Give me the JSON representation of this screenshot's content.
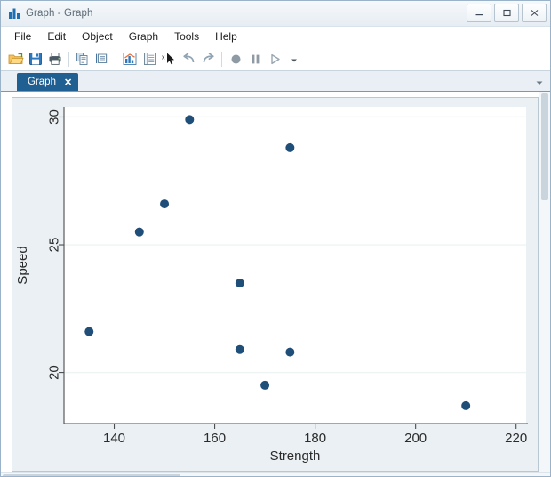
{
  "window": {
    "title": "Graph - Graph",
    "app_icon": "bar-chart-icon",
    "controls": {
      "minimize": "–",
      "maximize": "□",
      "close": "✕"
    }
  },
  "menu": {
    "items": [
      {
        "label": "File"
      },
      {
        "label": "Edit"
      },
      {
        "label": "Object"
      },
      {
        "label": "Graph"
      },
      {
        "label": "Tools"
      },
      {
        "label": "Help"
      }
    ]
  },
  "toolbar": {
    "buttons": [
      {
        "name": "open-folder-icon",
        "tooltip": "Open"
      },
      {
        "name": "save-icon",
        "tooltip": "Save"
      },
      {
        "name": "print-icon",
        "tooltip": "Print"
      },
      {
        "name": "copy-icon",
        "tooltip": "Copy"
      },
      {
        "name": "paste-object-icon",
        "tooltip": "Paste"
      },
      {
        "name": "new-graph-icon",
        "tooltip": "New Graph"
      },
      {
        "name": "grid-editor-icon",
        "tooltip": "Grid Editor"
      },
      {
        "name": "pointer-select-icon",
        "tooltip": "Select"
      },
      {
        "name": "undo-icon",
        "tooltip": "Undo"
      },
      {
        "name": "redo-icon",
        "tooltip": "Redo"
      },
      {
        "name": "record-icon",
        "tooltip": "Record"
      },
      {
        "name": "pause-icon",
        "tooltip": "Pause"
      },
      {
        "name": "play-icon",
        "tooltip": "Play"
      },
      {
        "name": "chevron-down-icon",
        "tooltip": "More"
      }
    ]
  },
  "tabs": {
    "items": [
      {
        "label": "Graph",
        "close": "✕",
        "active": true
      }
    ],
    "dropdown_icon": "chevron-down-icon"
  },
  "chart_data": {
    "type": "scatter",
    "title": "",
    "xlabel": "Strength",
    "ylabel": "Speed",
    "xlim": [
      130,
      222
    ],
    "ylim": [
      18.0,
      30.4
    ],
    "xticks": [
      140,
      160,
      180,
      200,
      220
    ],
    "yticks": [
      20,
      25,
      30
    ],
    "grid": "horizontal",
    "marker_color": "#1f4e79",
    "marker_size": 5,
    "plot_bg": "#ffffff",
    "figure_bg": "#eaf0f3",
    "points": [
      {
        "x": 135.0,
        "y": 21.6
      },
      {
        "x": 145.0,
        "y": 25.5
      },
      {
        "x": 150.0,
        "y": 26.6
      },
      {
        "x": 155.0,
        "y": 29.9
      },
      {
        "x": 165.0,
        "y": 23.5
      },
      {
        "x": 165.0,
        "y": 20.9
      },
      {
        "x": 170.0,
        "y": 19.5
      },
      {
        "x": 175.0,
        "y": 20.8
      },
      {
        "x": 175.0,
        "y": 28.8
      },
      {
        "x": 210.0,
        "y": 18.7
      }
    ]
  }
}
